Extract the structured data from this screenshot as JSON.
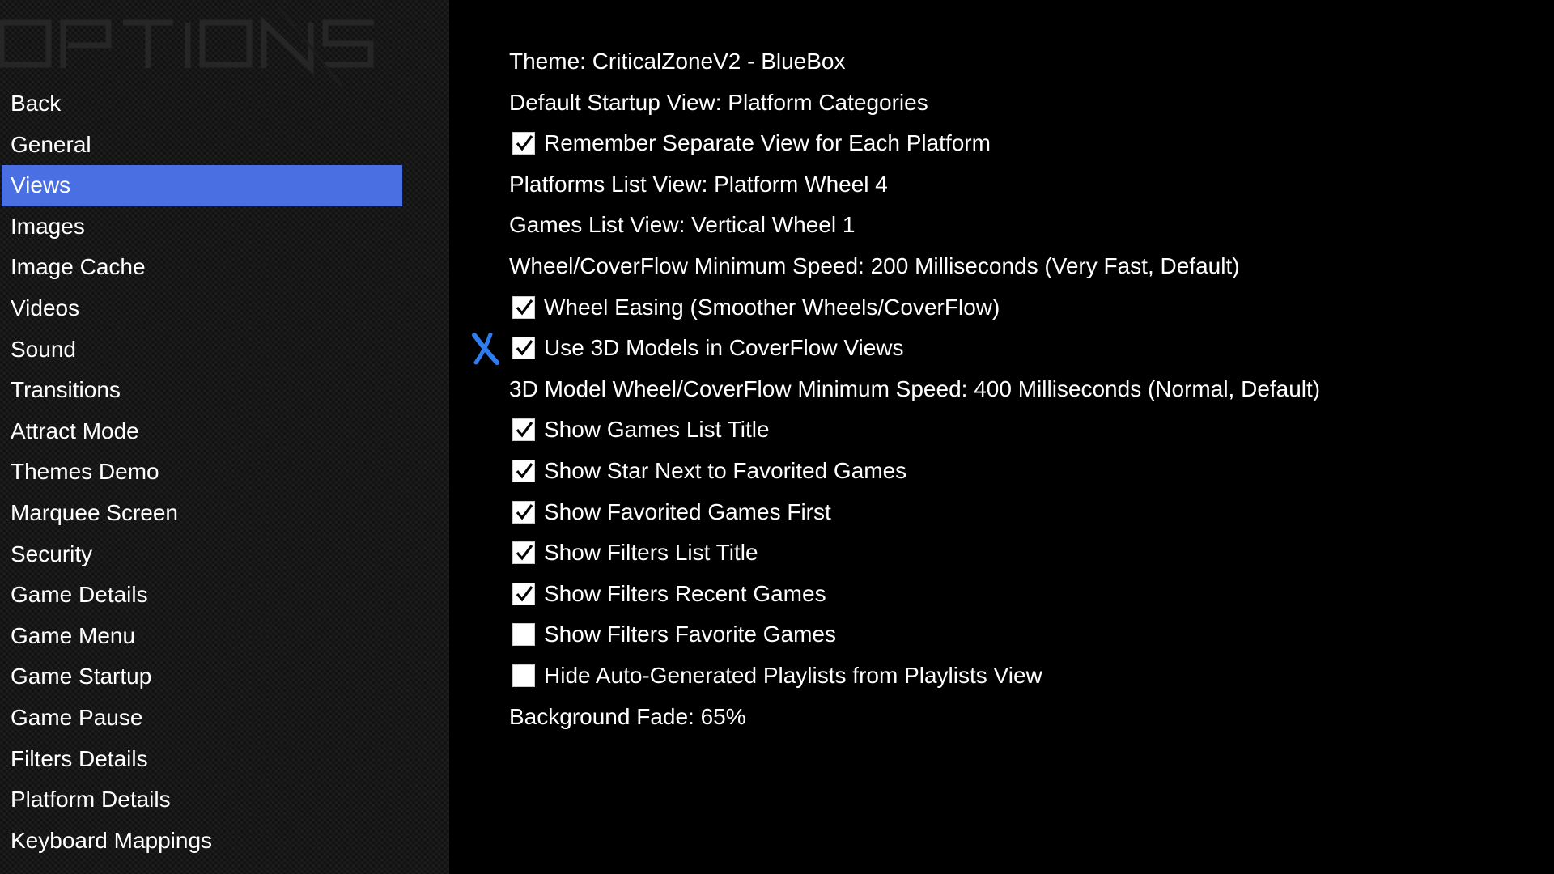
{
  "header": {
    "title_graphic": "OPTIONS"
  },
  "colors": {
    "accent": "#4a6fe3",
    "cursor": "#2f7bf0",
    "background": "#000000",
    "text": "#ffffff"
  },
  "sidebar": {
    "selected": "Views",
    "items": [
      {
        "label": "Back"
      },
      {
        "label": "General"
      },
      {
        "label": "Views"
      },
      {
        "label": "Images"
      },
      {
        "label": "Image Cache"
      },
      {
        "label": "Videos"
      },
      {
        "label": "Sound"
      },
      {
        "label": "Transitions"
      },
      {
        "label": "Attract Mode"
      },
      {
        "label": "Themes Demo"
      },
      {
        "label": "Marquee Screen"
      },
      {
        "label": "Security"
      },
      {
        "label": "Game Details"
      },
      {
        "label": "Game Menu"
      },
      {
        "label": "Game Startup"
      },
      {
        "label": "Game Pause"
      },
      {
        "label": "Filters Details"
      },
      {
        "label": "Platform Details"
      },
      {
        "label": "Keyboard Mappings"
      }
    ]
  },
  "settings": {
    "cursor_icon": "x-cursor-icon",
    "items": [
      {
        "label": "Theme: CriticalZoneV2 - BlueBox",
        "type": "value"
      },
      {
        "label": "Default Startup View: Platform Categories",
        "type": "value"
      },
      {
        "label": "Remember Separate View for Each Platform",
        "type": "checkbox",
        "checked": true
      },
      {
        "label": "Platforms List View: Platform Wheel 4",
        "type": "value"
      },
      {
        "label": "Games List View: Vertical Wheel 1",
        "type": "value"
      },
      {
        "label": "Wheel/CoverFlow Minimum Speed: 200 Milliseconds (Very Fast, Default)",
        "type": "value"
      },
      {
        "label": "Wheel Easing (Smoother Wheels/CoverFlow)",
        "type": "checkbox",
        "checked": true
      },
      {
        "label": "Use 3D Models in CoverFlow Views",
        "type": "checkbox",
        "checked": true,
        "focused": true
      },
      {
        "label": "3D Model Wheel/CoverFlow Minimum Speed: 400 Milliseconds (Normal, Default)",
        "type": "value"
      },
      {
        "label": "Show Games List Title",
        "type": "checkbox",
        "checked": true
      },
      {
        "label": "Show Star Next to Favorited Games",
        "type": "checkbox",
        "checked": true
      },
      {
        "label": "Show Favorited Games First",
        "type": "checkbox",
        "checked": true
      },
      {
        "label": "Show Filters List Title",
        "type": "checkbox",
        "checked": true
      },
      {
        "label": "Show Filters Recent Games",
        "type": "checkbox",
        "checked": true
      },
      {
        "label": "Show Filters Favorite Games",
        "type": "checkbox",
        "checked": false
      },
      {
        "label": "Hide Auto-Generated Playlists from Playlists View",
        "type": "checkbox",
        "checked": false
      },
      {
        "label": "Background Fade: 65%",
        "type": "value"
      }
    ]
  }
}
